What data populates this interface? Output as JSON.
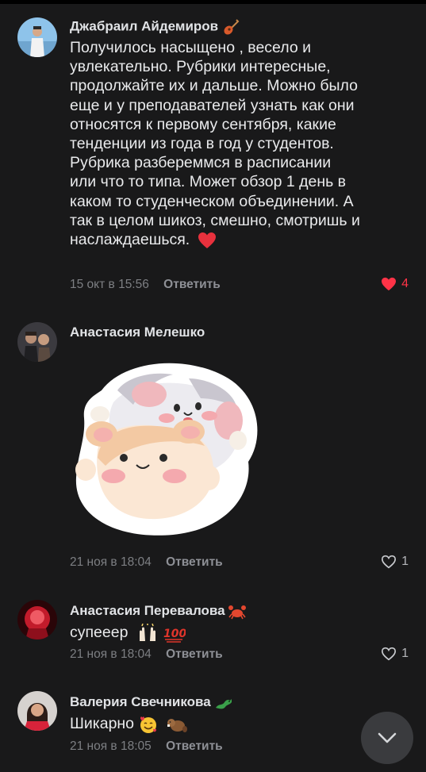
{
  "comments": [
    {
      "author": "Джабраил Айдемиров",
      "text_lines": [
        "Получилось насыщено , весело и",
        "увлекательно. Рубрики интересные,",
        "продолжайте их и дальше. Можно было",
        "еще и у преподавателей узнать как они",
        "относятся к первому сентября, какие",
        "тенденции из года в год у студентов.",
        "Рубрика разбереммся в расписании",
        "или что то типа. Может обзор 1 день в",
        "каком то студенческом объединении. А",
        "так в целом шикоз, смешно, смотришь и",
        "наслаждаешься."
      ],
      "date": "15 окт в 15:56",
      "reply_label": "Ответить",
      "likes": "4",
      "liked": true
    },
    {
      "author": "Анастасия Мелешко",
      "sticker": "two-hamsters-thumbs-up-sticker",
      "date": "21 ноя в 18:04",
      "reply_label": "Ответить",
      "likes": "1",
      "liked": false
    },
    {
      "author": "Анастасия Перевалова",
      "text": "супееер",
      "date": "21 ноя в 18:04",
      "reply_label": "Ответить",
      "likes": "1",
      "liked": false
    },
    {
      "author": "Валерия Свечникова",
      "text": "Шикарно",
      "date": "21 ноя в 18:05",
      "reply_label": "Ответить"
    }
  ],
  "colors": {
    "background": "#19191a",
    "liked_heart": "#ff3347",
    "meta_text": "#7d7f83"
  },
  "scroll_button_icon": "chevron-down-icon"
}
